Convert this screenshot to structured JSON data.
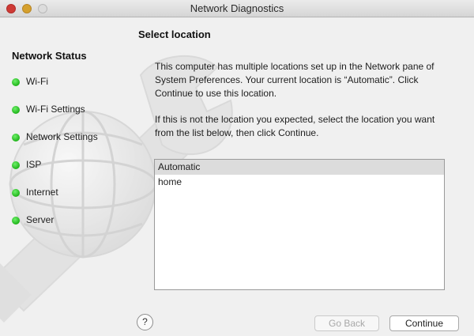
{
  "window": {
    "title": "Network Diagnostics",
    "controls": [
      "close",
      "minimize",
      "zoom"
    ]
  },
  "sidebar": {
    "heading": "Network Status",
    "items": [
      {
        "label": "Wi-Fi",
        "status": "green"
      },
      {
        "label": "Wi-Fi Settings",
        "status": "green"
      },
      {
        "label": "Network Settings",
        "status": "green"
      },
      {
        "label": "ISP",
        "status": "green"
      },
      {
        "label": "Internet",
        "status": "green"
      },
      {
        "label": "Server",
        "status": "green"
      }
    ]
  },
  "main": {
    "title": "Select location",
    "paragraph1": "This computer has multiple locations set up in the Network pane of System Preferences. Your current location is “Automatic”. Click Continue to use this location.",
    "paragraph2": "If this is not the location you expected, select the location you want from the list below, then click Continue.",
    "locations": [
      {
        "label": "Automatic",
        "selected": true
      },
      {
        "label": "home",
        "selected": false
      }
    ]
  },
  "footer": {
    "help_label": "?",
    "back_label": "Go Back",
    "back_enabled": false,
    "continue_label": "Continue"
  },
  "colors": {
    "status_green": "#2ac626",
    "selection": "#dcdcdc"
  }
}
